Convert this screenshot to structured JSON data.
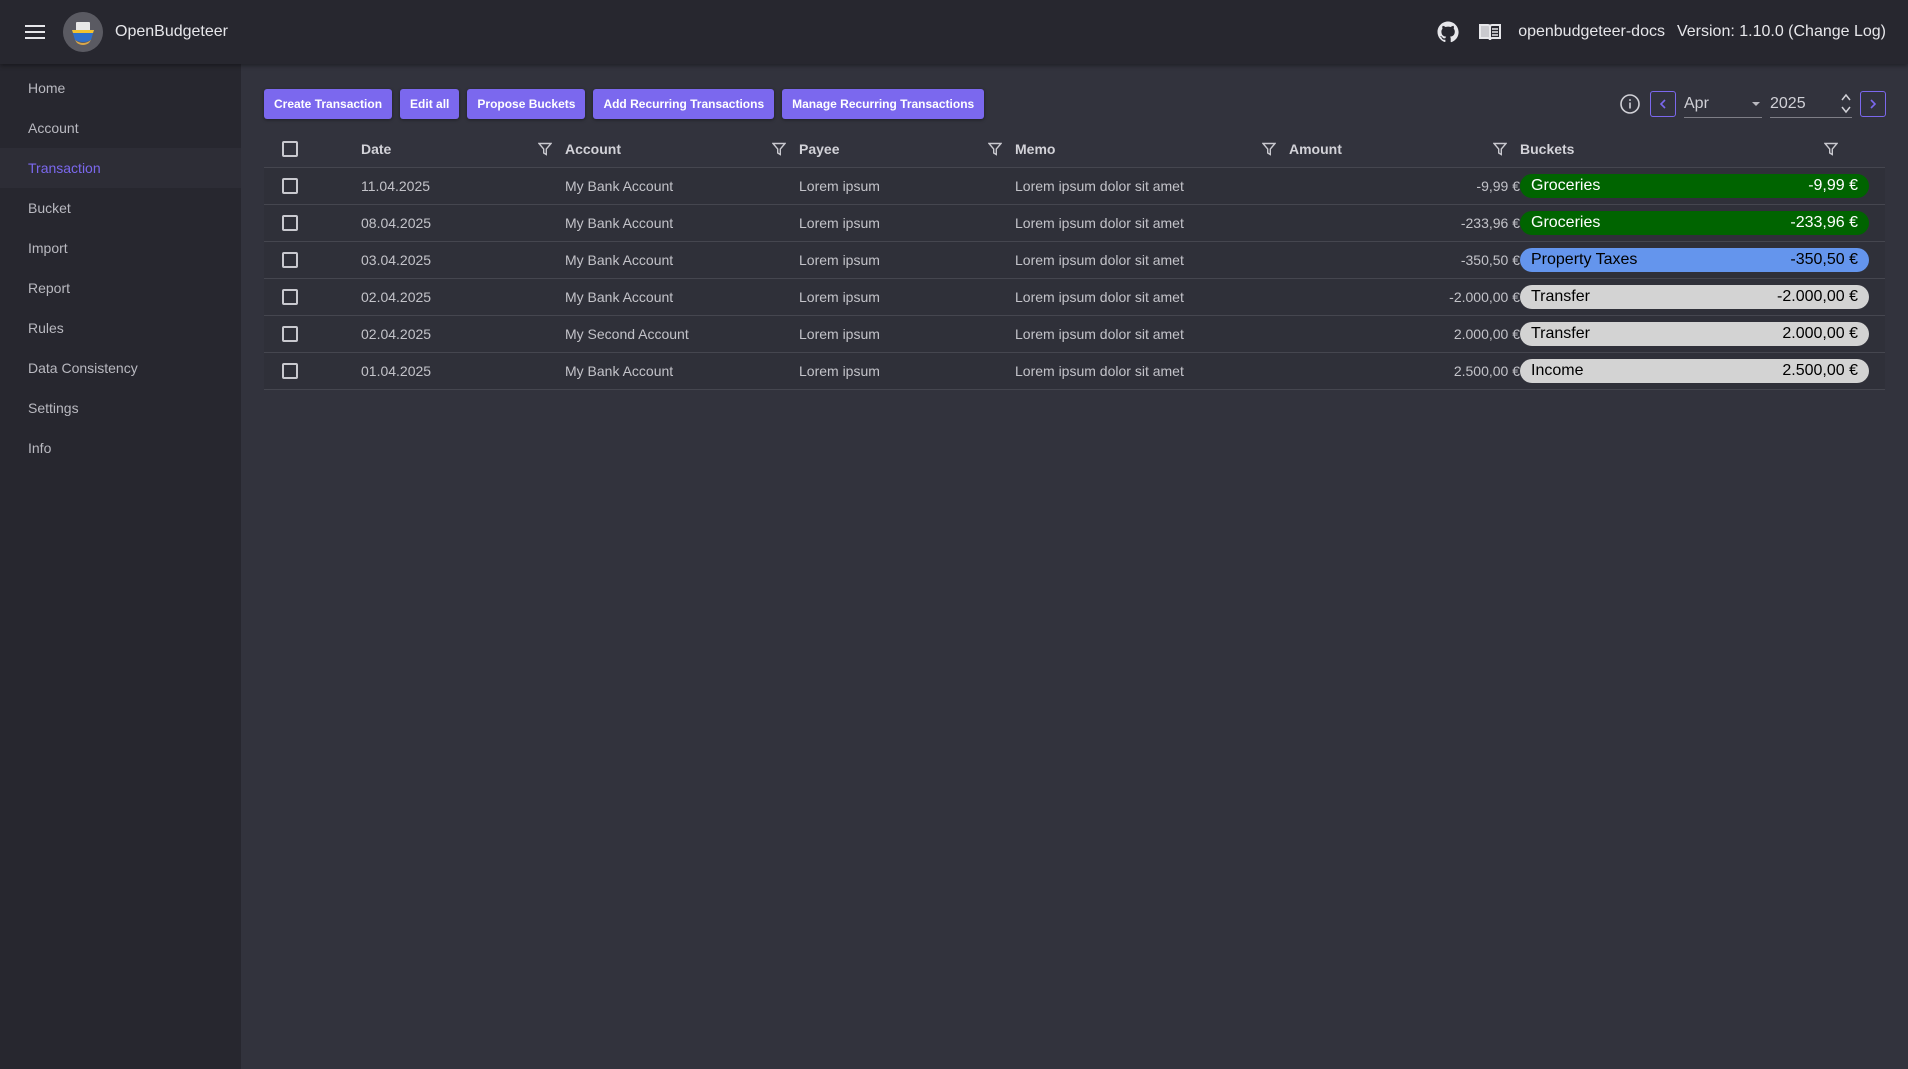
{
  "app": {
    "title": "OpenBudgeteer",
    "docs_link": "openbudgeteer-docs",
    "version": "Version: 1.10.0 (Change Log)"
  },
  "sidebar": {
    "items": [
      {
        "label": "Home"
      },
      {
        "label": "Account"
      },
      {
        "label": "Transaction"
      },
      {
        "label": "Bucket"
      },
      {
        "label": "Import"
      },
      {
        "label": "Report"
      },
      {
        "label": "Rules"
      },
      {
        "label": "Data Consistency"
      },
      {
        "label": "Settings"
      },
      {
        "label": "Info"
      }
    ],
    "active": "Transaction"
  },
  "toolbar": {
    "create": "Create Transaction",
    "edit_all": "Edit all",
    "propose": "Propose Buckets",
    "add_recurring": "Add Recurring Transactions",
    "manage_recurring": "Manage Recurring Transactions"
  },
  "date_nav": {
    "month": "Apr",
    "year": "2025"
  },
  "table": {
    "headers": {
      "date": "Date",
      "account": "Account",
      "payee": "Payee",
      "memo": "Memo",
      "amount": "Amount",
      "buckets": "Buckets"
    },
    "rows": [
      {
        "date": "11.04.2025",
        "account": "My Bank Account",
        "payee": "Lorem ipsum",
        "memo": "Lorem ipsum dolor sit amet",
        "amount": "-9,99 €",
        "bucket": "Groceries",
        "bucket_amount": "-9,99 €",
        "bucket_color": "#006400",
        "bucket_text_color": "#ffffff"
      },
      {
        "date": "08.04.2025",
        "account": "My Bank Account",
        "payee": "Lorem ipsum",
        "memo": "Lorem ipsum dolor sit amet",
        "amount": "-233,96 €",
        "bucket": "Groceries",
        "bucket_amount": "-233,96 €",
        "bucket_color": "#006400",
        "bucket_text_color": "#ffffff"
      },
      {
        "date": "03.04.2025",
        "account": "My Bank Account",
        "payee": "Lorem ipsum",
        "memo": "Lorem ipsum dolor sit amet",
        "amount": "-350,50 €",
        "bucket": "Property Taxes",
        "bucket_amount": "-350,50 €",
        "bucket_color": "#6495ed",
        "bucket_text_color": "#000000"
      },
      {
        "date": "02.04.2025",
        "account": "My Bank Account",
        "payee": "Lorem ipsum",
        "memo": "Lorem ipsum dolor sit amet",
        "amount": "-2.000,00 €",
        "bucket": "Transfer",
        "bucket_amount": "-2.000,00 €",
        "bucket_color": "#d3d3d3",
        "bucket_text_color": "#000000"
      },
      {
        "date": "02.04.2025",
        "account": "My Second Account",
        "payee": "Lorem ipsum",
        "memo": "Lorem ipsum dolor sit amet",
        "amount": "2.000,00 €",
        "bucket": "Transfer",
        "bucket_amount": "2.000,00 €",
        "bucket_color": "#d3d3d3",
        "bucket_text_color": "#000000"
      },
      {
        "date": "01.04.2025",
        "account": "My Bank Account",
        "payee": "Lorem ipsum",
        "memo": "Lorem ipsum dolor sit amet",
        "amount": "2.500,00 €",
        "bucket": "Income",
        "bucket_amount": "2.500,00 €",
        "bucket_color": "#d3d3d3",
        "bucket_text_color": "#000000"
      }
    ]
  },
  "colors": {
    "accent": "#7b68ee",
    "appbar": "#27272f",
    "background": "#32333d"
  },
  "icons": [
    "menu-icon",
    "github-icon",
    "book-icon",
    "info-icon",
    "chevron-left-icon",
    "chevron-right-icon",
    "dropdown-arrow-icon",
    "spin-up-icon",
    "spin-down-icon",
    "filter-icon",
    "checkbox-icon"
  ]
}
